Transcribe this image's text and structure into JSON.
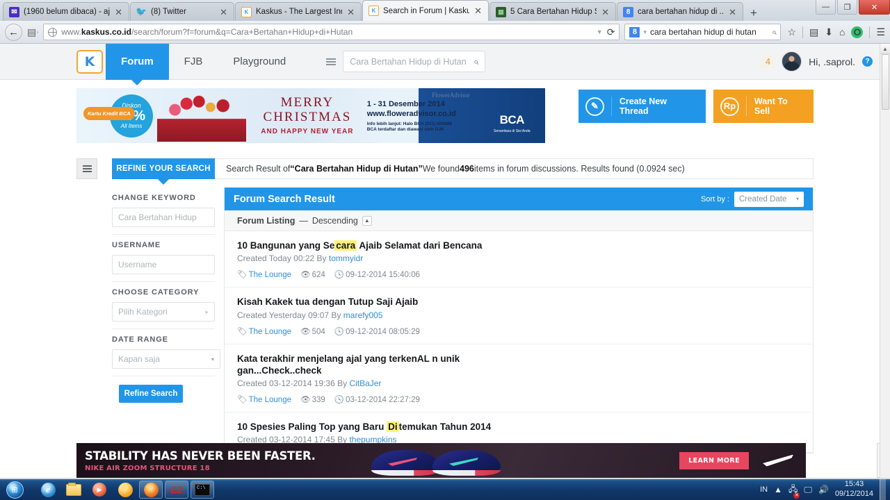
{
  "browser": {
    "tabs": [
      {
        "title": "(1960 belum dibaca) - aj...",
        "favicon": "mail-icon",
        "active": false
      },
      {
        "title": "(8) Twitter",
        "favicon": "twitter-icon",
        "active": false
      },
      {
        "title": "Kaskus - The Largest Ind...",
        "favicon": "kaskus-icon",
        "active": false
      },
      {
        "title": "Search in Forum | Kasku...",
        "favicon": "kaskus-icon",
        "active": true
      },
      {
        "title": "5 Cara Bertahan Hidup S...",
        "favicon": "green-icon",
        "active": false
      },
      {
        "title": "cara bertahan hidup di ...",
        "favicon": "google-icon",
        "active": false
      }
    ],
    "new_tab_label": "+",
    "window_controls": {
      "minimize": "—",
      "maximize": "❐",
      "close": "✕"
    },
    "url": {
      "prefix": "www.",
      "domain": "kaskus.co.id",
      "path": "/search/forum?f=forum&q=Cara+Bertahan+Hidup+di+Hutan"
    },
    "search": {
      "engine": "8",
      "value": "cara bertahan hidup di hutan"
    },
    "toolbar_icons": [
      "bookmark-star-icon",
      "reader-icon",
      "download-icon",
      "home-icon",
      "opera-icon",
      "menu-icon"
    ]
  },
  "site": {
    "logo_text": "K",
    "nav": [
      {
        "label": "Forum",
        "active": true
      },
      {
        "label": "FJB",
        "active": false
      },
      {
        "label": "Playground",
        "active": false
      }
    ],
    "search_placeholder": "Cara Bertahan Hidup di Hutan",
    "notification_count": "4",
    "greeting": "Hi, .saprol.",
    "help_label": "?"
  },
  "ad_banner": {
    "kartu_kredit": "Kartu Kredit BCA",
    "diskon_label": "Diskon",
    "diskon_value": "25%",
    "diskon_sub": "All Items",
    "merry": "MERRY",
    "christmas": "CHRISTMAS",
    "happy_new_year": "AND HAPPY NEW YEAR",
    "date_range": "1 - 31 Desember 2014",
    "website": "www.floweradvisor.co.id",
    "info_line1": "Info lebih lanjut: Halo BCA (021) 500888",
    "info_line2": "BCA terdaftar dan diawasi oleh OJK",
    "flower_advisor": "FlowerAdvisor",
    "bca": "BCA",
    "bca_tagline": "Senantiasa di Sisi Anda"
  },
  "actions": {
    "create_thread": {
      "label": "Create New Thread",
      "icon": "pencil-icon"
    },
    "want_to_sell": {
      "label": "Want To Sell",
      "icon": "rupiah-icon"
    }
  },
  "refine_tab_label": "REFINE YOUR SEARCH",
  "result_summary": {
    "prefix": "Search Result of ",
    "query": "“Cara Bertahan Hidup di Hutan”",
    "middle": " We found ",
    "count": "496",
    "suffix": " items in forum discussions. Results found (0.0924 sec)"
  },
  "sidebar": {
    "blocks": [
      {
        "label": "CHANGE KEYWORD",
        "value": "Cara Bertahan Hidup",
        "type": "text"
      },
      {
        "label": "USERNAME",
        "value": "Username",
        "type": "text"
      },
      {
        "label": "CHOOSE CATEGORY",
        "value": "Pilih Kategori",
        "type": "nav"
      },
      {
        "label": "DATE RANGE",
        "value": "Kapan saja",
        "type": "select"
      }
    ],
    "refine_button": "Refine Search"
  },
  "results_panel": {
    "title": "Forum Search Result",
    "sort_by_label": "Sort by :",
    "sort_value": "Created Date",
    "listing_label": "Forum Listing",
    "listing_dash": "—",
    "listing_order": "Descending",
    "items": [
      {
        "title_before": "10 Bangunan yang Se",
        "title_highlight": "cara",
        "title_after": " Ajaib Selamat dari Bencana",
        "created": "Created Today 00:22 By ",
        "author": "tommyidr",
        "forum": "The Lounge",
        "views": "624",
        "timestamp": "09-12-2014 15:40:06"
      },
      {
        "title_before": "Kisah Kakek tua dengan Tutup Saji Ajaib",
        "title_highlight": "",
        "title_after": "",
        "created": "Created Yesterday 09:07 By ",
        "author": "marefy005",
        "forum": "The Lounge",
        "views": "504",
        "timestamp": "09-12-2014 08:05:29"
      },
      {
        "title_before": "Kata terakhir menjelang ajal yang terkenAL n unik gan...Check..check",
        "title_highlight": "",
        "title_after": "",
        "created": "Created 03-12-2014 19:36 By ",
        "author": "CitBaJer",
        "forum": "The Lounge",
        "views": "339",
        "timestamp": "03-12-2014 22:27:29"
      },
      {
        "title_before": "10 Spesies Paling Top yang Baru ",
        "title_highlight": "Di",
        "title_after": "temukan Tahun 2014",
        "created": "Created 03-12-2014 17:45 By ",
        "author": "thepumpkins",
        "forum": "",
        "views": "",
        "timestamp": ""
      }
    ]
  },
  "nike_ad": {
    "headline": "STABILITY HAS NEVER BEEN FASTER.",
    "subline": "NIKE AIR ZOOM STRUCTURE 18",
    "cta": "LEARN MORE",
    "collapse": "«"
  },
  "taskbar": {
    "apps": [
      "internet-explorer-icon",
      "file-explorer-icon",
      "media-player-icon",
      "sun-icon",
      "firefox-icon",
      "ez-icon",
      "command-prompt-icon"
    ],
    "language": "IN",
    "time": "15:43",
    "date": "09/12/2014"
  }
}
